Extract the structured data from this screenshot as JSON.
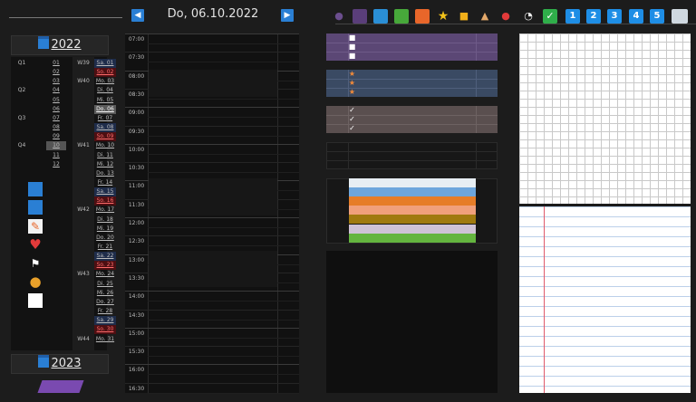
{
  "header": {
    "date": "Do, 06.10.2022",
    "prev_icon": "previous-arrow",
    "next_icon": "next-arrow",
    "toolbar_numbers": [
      "1",
      "2",
      "3",
      "4",
      "5"
    ],
    "toolbar_icons": [
      "person-purple",
      "bookmark-purple",
      "bookmark-blue",
      "bookmark-green",
      "bookmark-orange",
      "star",
      "lock",
      "house",
      "bell",
      "clock",
      "checkbox",
      "laptop"
    ]
  },
  "calendar": {
    "year_current": "2022",
    "year_next": "2023",
    "quarters": [
      "Q1",
      "Q2",
      "Q3",
      "Q4"
    ],
    "months": [
      "01",
      "02",
      "03",
      "04",
      "05",
      "06",
      "07",
      "08",
      "09",
      "10",
      "11",
      "12"
    ],
    "weeks": [
      {
        "label": "W39",
        "row": 0
      },
      {
        "label": "W40",
        "row": 2
      },
      {
        "label": "W41",
        "row": 9
      },
      {
        "label": "W42",
        "row": 16
      },
      {
        "label": "W43",
        "row": 23
      },
      {
        "label": "W44",
        "row": 30
      }
    ],
    "days": [
      "Sa. 01",
      "So. 02",
      "Mo. 03",
      "Di. 04",
      "Mi. 05",
      "Do. 06",
      "Fr. 07",
      "Sa. 08",
      "So. 09",
      "Mo. 10",
      "Di. 11",
      "Mi. 12",
      "Do. 13",
      "Fr. 14",
      "Sa. 15",
      "So. 16",
      "Mo. 17",
      "Di. 18",
      "Mi. 19",
      "Do. 20",
      "Fr. 21",
      "Sa. 22",
      "So. 23",
      "Mo. 24",
      "Di. 25",
      "Mi. 26",
      "Do. 27",
      "Fr. 28",
      "Sa. 29",
      "So. 30",
      "Mo. 31"
    ]
  },
  "side_icons": [
    "calendar-icon",
    "calendar-icon",
    "notes-icon",
    "heart-icon",
    "runner-icon",
    "coin-icon",
    "blank-page-icon"
  ],
  "schedule": {
    "times": [
      "07:00",
      "07:30",
      "08:00",
      "08:30",
      "09:00",
      "09:30",
      "10:00",
      "10:30",
      "11:00",
      "11:30",
      "12:00",
      "12:30",
      "13:00",
      "13:30",
      "14:00",
      "14:30",
      "15:00",
      "15:30",
      "16:00",
      "16:30"
    ]
  },
  "lists": {
    "todo_marks": [
      "■",
      "■",
      "■"
    ],
    "star_marks": [
      "★",
      "★",
      "★"
    ],
    "check_marks": [
      "✓",
      "✓",
      "✓"
    ]
  },
  "colors": {
    "accent": "#2a7fd4",
    "purple_box": "#5b4775",
    "blue_box": "#3a4a63",
    "brown_box": "#5a4f4f",
    "color_bars": [
      "#e7eef3",
      "#6da6dc",
      "#e67d28",
      "#f0a07c",
      "#a07a10",
      "#cfc2d6",
      "#64b53f"
    ]
  }
}
